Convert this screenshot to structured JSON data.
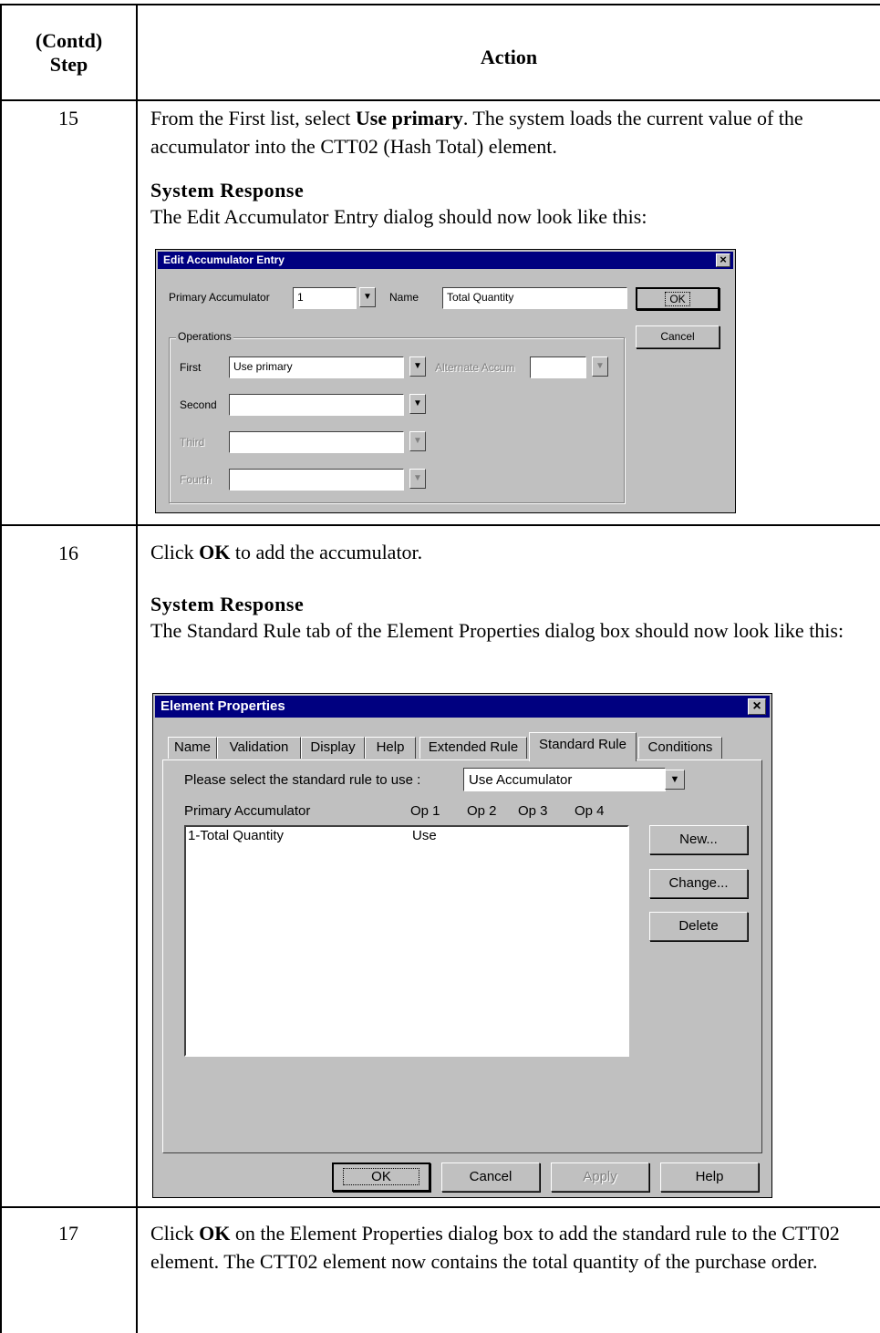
{
  "table": {
    "header_step": "(Contd)\nStep",
    "header_step_line1": "(Contd)",
    "header_step_line2": "Step",
    "header_action": "Action"
  },
  "rows": [
    {
      "step": "15",
      "text_parts": [
        "From the First list, select ",
        "Use primary",
        ". The system loads the current value of the accumulator into the CTT02 (Hash Total) element."
      ],
      "system_response_title": "System Response",
      "system_response_text": "The Edit Accumulator Entry dialog should now look like this:"
    },
    {
      "step": "16",
      "text_parts": [
        "Click ",
        "OK",
        " to add the accumulator."
      ],
      "system_response_title": "System Response",
      "system_response_text": "The Standard Rule tab of the Element Properties dialog box should now look like this:"
    },
    {
      "step": "17",
      "text_parts": [
        "Click ",
        "OK",
        " on the Element Properties dialog box to add the standard rule to the CTT02 element. The CTT02 element now contains the total quantity of the purchase order."
      ]
    }
  ],
  "edit_accumulator_dialog": {
    "title": "Edit Accumulator Entry",
    "close_glyph": "×",
    "primary_accumulator_label": "Primary Accumulator",
    "primary_accumulator_value": "1",
    "name_label": "Name",
    "name_value": "Total Quantity",
    "ok_label": "OK",
    "cancel_label": "Cancel",
    "operations_group_label": "Operations",
    "first_label": "First",
    "first_value": "Use primary",
    "alternate_accum_label": "Alternate Accum",
    "alternate_accum_value": "",
    "second_label": "Second",
    "second_value": "",
    "third_label": "Third",
    "third_value": "",
    "fourth_label": "Fourth",
    "fourth_value": ""
  },
  "element_properties_dialog": {
    "title": "Element Properties",
    "close_glyph": "×",
    "tabs": [
      "Name",
      "Validation",
      "Display",
      "Help",
      "Extended Rule",
      "Standard Rule",
      "Conditions"
    ],
    "active_tab": "Standard Rule",
    "select_rule_label": "Please select the standard rule to use :",
    "select_rule_value": "Use Accumulator",
    "list_headers": [
      "Primary Accumulator",
      "Op 1",
      "Op 2",
      "Op 3",
      "Op 4"
    ],
    "list_rows": [
      {
        "accumulator": "1-Total Quantity",
        "op1": "Use",
        "op2": "",
        "op3": "",
        "op4": ""
      }
    ],
    "new_label": "New...",
    "change_label": "Change...",
    "delete_label": "Delete",
    "ok_label": "OK",
    "cancel_label": "Cancel",
    "apply_label": "Apply",
    "help_label": "Help"
  },
  "colors": {
    "titlebar": "#000080",
    "dialog_face": "#c0c0c0",
    "disabled_text": "#808080"
  }
}
